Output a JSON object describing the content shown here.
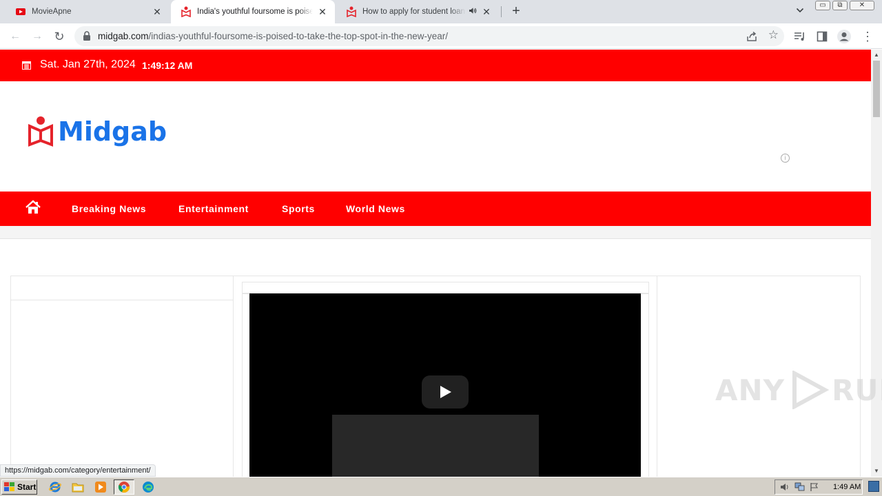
{
  "browser": {
    "tabs": [
      {
        "title": "MovieApne",
        "active": false
      },
      {
        "title": "India's youthful foursome is poised to take the top spot",
        "active": true
      },
      {
        "title": "How to apply for student loan for",
        "active": false,
        "audio": true
      }
    ],
    "close_glyph": "✕",
    "new_tab_glyph": "+",
    "tab_search_glyph": "⌄",
    "window_controls": [
      "▭",
      "⧉",
      "✕"
    ],
    "nav": {
      "back": "←",
      "forward": "→",
      "reload": "↻"
    },
    "address": {
      "host": "midgab.com",
      "path": "/indias-youthful-foursome-is-poised-to-take-the-top-spot-in-the-new-year/"
    },
    "bookmark_glyph": "☆",
    "menu_glyph": "⋮"
  },
  "site": {
    "date": "Sat. Jan 27th, 2024",
    "time": "1:49:12 AM",
    "logo_text": "Midgab",
    "ad_info_glyph": "i",
    "nav_items": [
      "Breaking News",
      "Entertainment",
      "Sports",
      "World News"
    ]
  },
  "watermark": {
    "left": "ANY",
    "right": "RUN"
  },
  "status_url": "https://midgab.com/category/entertainment/",
  "taskbar": {
    "start_label": "Start",
    "clock": "1:49 AM"
  },
  "colors": {
    "brand_red": "#ff0000",
    "logo_blue": "#1a73e8",
    "tab_bg": "#dee1e6"
  },
  "icons": [
    "movie-favicon",
    "midgab-favicon",
    "speaker-icon",
    "lock-icon",
    "share-icon",
    "star-icon",
    "media-icon",
    "sidepanel-icon",
    "profile-icon",
    "calendar-icon",
    "home-icon",
    "play-icon",
    "ie-icon",
    "folder-icon",
    "media-player-icon",
    "chrome-icon",
    "edge-icon"
  ]
}
